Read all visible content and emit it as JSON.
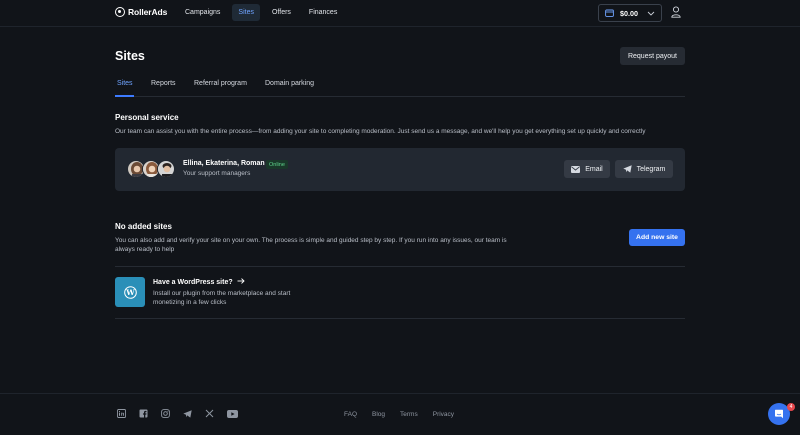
{
  "header": {
    "logo_text": "RollerAds",
    "nav": [
      {
        "label": "Campaigns"
      },
      {
        "label": "Sites",
        "active": true
      },
      {
        "label": "Offers"
      },
      {
        "label": "Finances"
      }
    ],
    "balance": "$0.00",
    "icons": {
      "wallet": "wallet-icon",
      "chevron": "chevron-down-icon",
      "user": "user-icon"
    }
  },
  "page": {
    "title": "Sites",
    "request_payout": "Request payout",
    "tabs": [
      {
        "label": "Sites",
        "active": true
      },
      {
        "label": "Reports"
      },
      {
        "label": "Referral program"
      },
      {
        "label": "Domain parking"
      }
    ]
  },
  "personal_service": {
    "title": "Personal service",
    "description": "Our team can assist you with the entire process—from adding your site to completing moderation. Just send us a message, and we'll help you get everything set up quickly and correctly",
    "managers": "Ellina, Ekaterina, Roman",
    "status": "Online",
    "subtitle": "Your support managers",
    "email_button": "Email",
    "telegram_button": "Telegram"
  },
  "no_sites": {
    "title": "No added sites",
    "description": "You can also add and verify your site on your own. The process is simple and guided step by step. If you run into any issues, our team is always ready to help",
    "add_button": "Add new site"
  },
  "wordpress": {
    "title": "Have a WordPress site?",
    "description": "Install our plugin from the marketplace and start monetizing in a few clicks"
  },
  "footer": {
    "socials": [
      "linkedin-icon",
      "facebook-icon",
      "instagram-icon",
      "telegram-icon",
      "x-icon",
      "youtube-icon"
    ],
    "links": [
      "FAQ",
      "Blog",
      "Terms",
      "Privacy"
    ]
  },
  "chat": {
    "badge": "4"
  },
  "colors": {
    "accent": "#3572ef",
    "background": "#111419",
    "card": "#222831",
    "online": "#5fd38c"
  }
}
